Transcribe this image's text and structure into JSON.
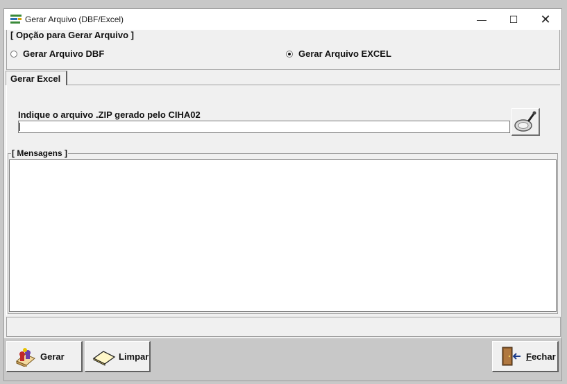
{
  "window": {
    "title": "Gerar Arquivo (DBF/Excel)",
    "min": "—",
    "max": "☐",
    "close": "✕"
  },
  "options": {
    "legend": "[ Opção para Gerar Arquivo ]",
    "dbf_label": "Gerar Arquivo DBF",
    "excel_label": "Gerar Arquivo EXCEL",
    "selected": "excel"
  },
  "tab": {
    "label": "Gerar Excel"
  },
  "file": {
    "label": "Indique o arquivo .ZIP gerado pelo CIHA02",
    "value": ""
  },
  "messages": {
    "legend": "[ Mensagens ]",
    "text": ""
  },
  "buttons": {
    "gerar": "Gerar",
    "limpar": "Limpar",
    "fechar_first": "F",
    "fechar_rest": "echar"
  }
}
